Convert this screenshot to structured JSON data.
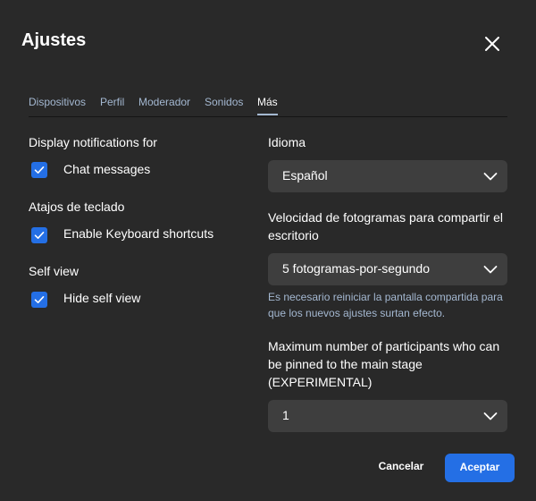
{
  "dialog": {
    "title": "Ajustes",
    "close_icon": "close-icon"
  },
  "tabs": [
    {
      "label": "Dispositivos",
      "active": false
    },
    {
      "label": "Perfil",
      "active": false
    },
    {
      "label": "Moderador",
      "active": false
    },
    {
      "label": "Sonidos",
      "active": false
    },
    {
      "label": "Más",
      "active": true
    }
  ],
  "left": {
    "notifications": {
      "heading": "Display notifications for",
      "option": "Chat messages",
      "checked": true
    },
    "shortcuts": {
      "heading": "Atajos de teclado",
      "option": "Enable Keyboard shortcuts",
      "checked": true
    },
    "self_view": {
      "heading": "Self view",
      "option": "Hide self view",
      "checked": true
    }
  },
  "right": {
    "language": {
      "label": "Idioma",
      "value": "Español"
    },
    "framerate": {
      "label": "Velocidad de fotogramas para compartir el escritorio",
      "value": "5 fotogramas-por-segundo",
      "helper": "Es necesario reiniciar la pantalla compartida para que los nuevos ajustes surtan efecto."
    },
    "max_pinned": {
      "label": "Maximum number of participants who can be pinned to the main stage (EXPERIMENTAL)",
      "value": "1"
    }
  },
  "footer": {
    "cancel": "Cancelar",
    "accept": "Aceptar"
  },
  "colors": {
    "background": "#292929",
    "accent": "#246fe5",
    "tab_text": "#a4b8d1",
    "select_bg": "#3e3e3e"
  }
}
